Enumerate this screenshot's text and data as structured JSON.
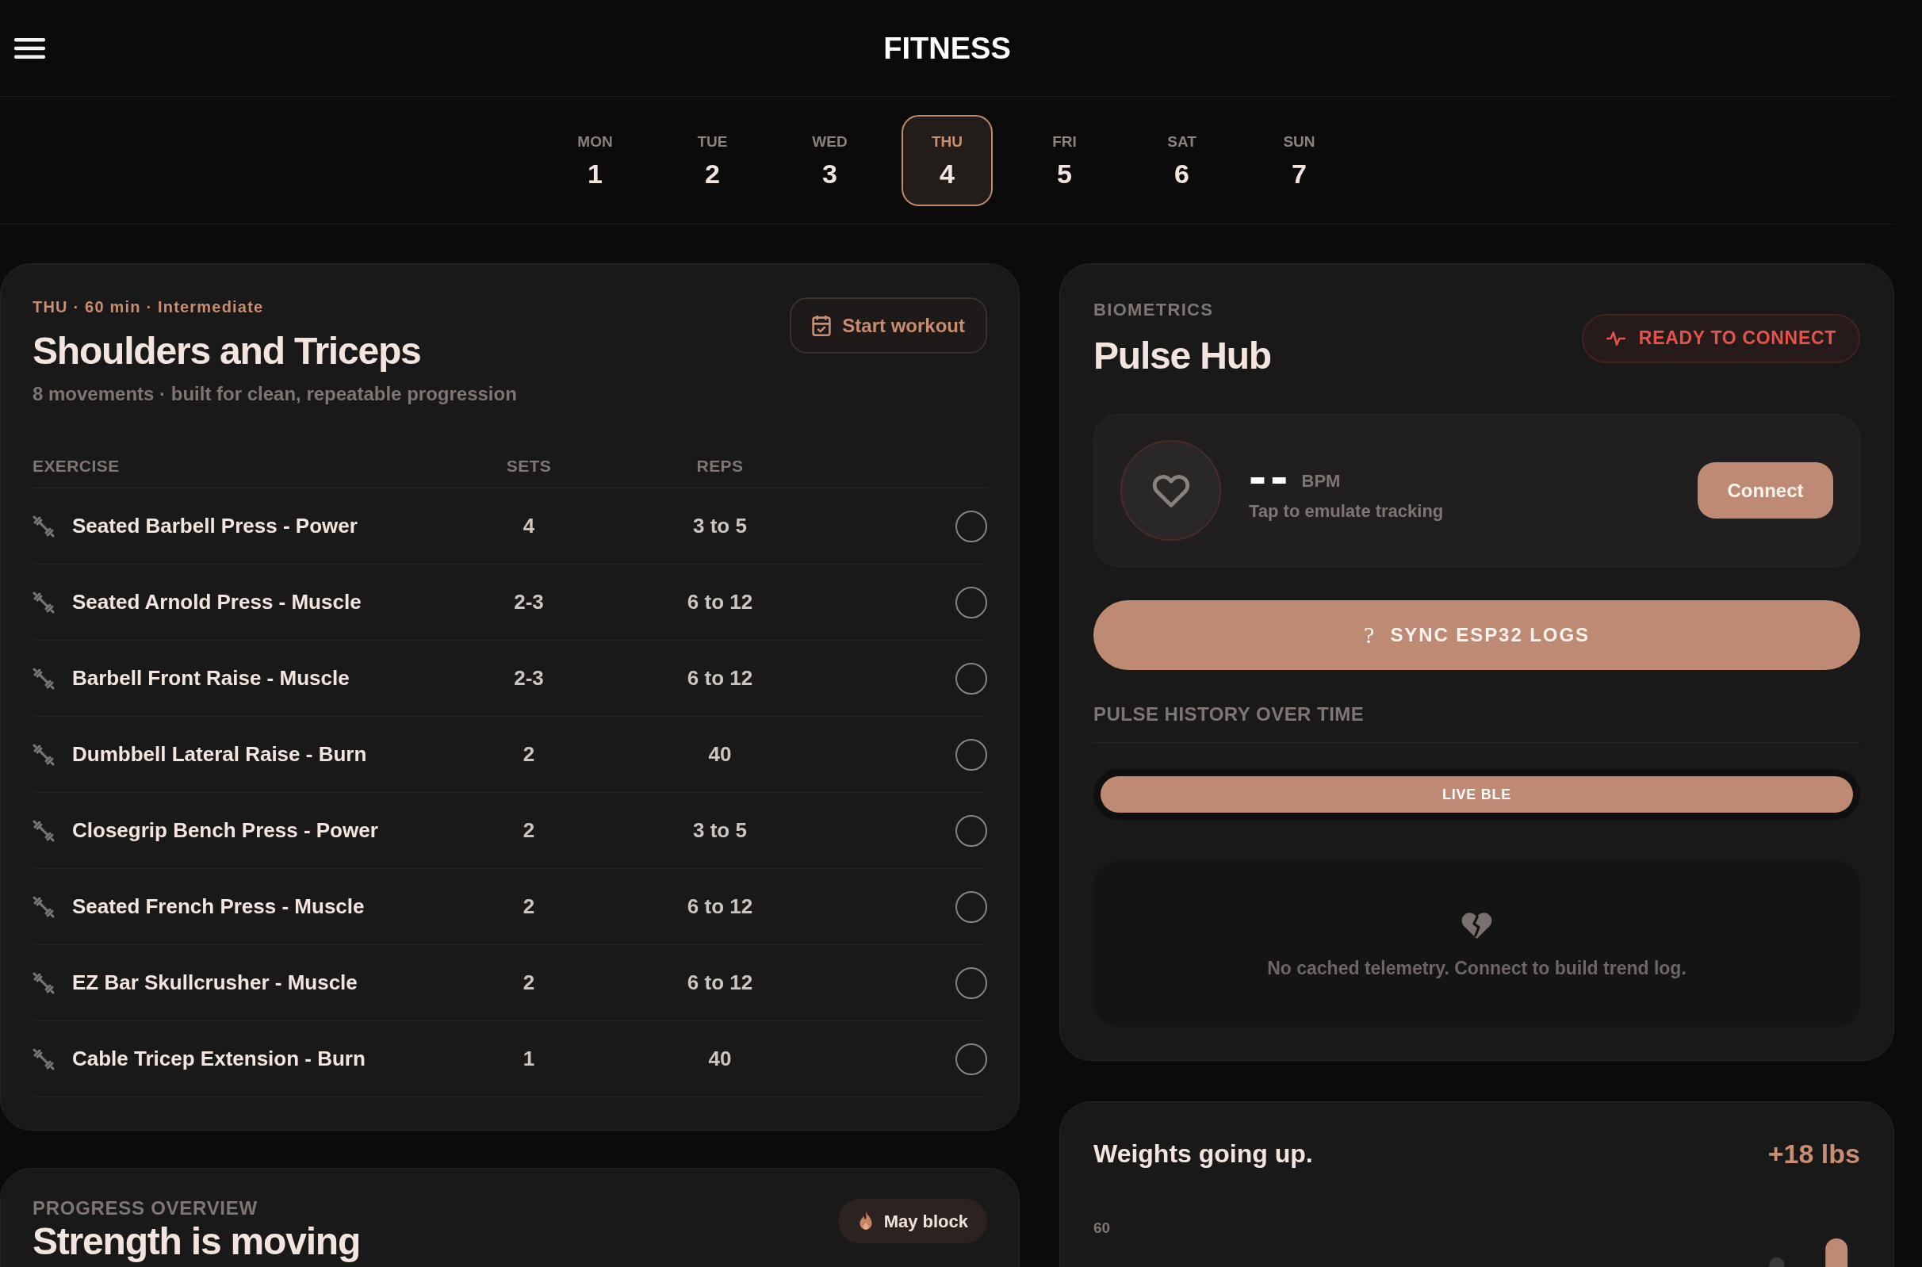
{
  "header": {
    "title": "FITNESS"
  },
  "days": [
    {
      "label": "MON",
      "date": "1",
      "selected": false
    },
    {
      "label": "TUE",
      "date": "2",
      "selected": false
    },
    {
      "label": "WED",
      "date": "3",
      "selected": false
    },
    {
      "label": "THU",
      "date": "4",
      "selected": true
    },
    {
      "label": "FRI",
      "date": "5",
      "selected": false
    },
    {
      "label": "SAT",
      "date": "6",
      "selected": false
    },
    {
      "label": "SUN",
      "date": "7",
      "selected": false
    }
  ],
  "workout": {
    "meta": "THU · 60 min · Intermediate",
    "title": "Shoulders and Triceps",
    "description": "8 movements · built for clean, repeatable progression",
    "start_button": "Start workout",
    "table": {
      "columns": [
        "EXERCISE",
        "SETS",
        "REPS"
      ],
      "rows": [
        {
          "exercise": "Seated Barbell Press - Power",
          "sets": "4",
          "reps": "3 to 5",
          "done": false
        },
        {
          "exercise": "Seated Arnold Press - Muscle",
          "sets": "2-3",
          "reps": "6 to 12",
          "done": false
        },
        {
          "exercise": "Barbell Front Raise - Muscle",
          "sets": "2-3",
          "reps": "6 to 12",
          "done": false
        },
        {
          "exercise": "Dumbbell Lateral Raise - Burn",
          "sets": "2",
          "reps": "40",
          "done": false
        },
        {
          "exercise": "Closegrip Bench Press - Power",
          "sets": "2",
          "reps": "3 to 5",
          "done": false
        },
        {
          "exercise": "Seated French Press - Muscle",
          "sets": "2",
          "reps": "6 to 12",
          "done": false
        },
        {
          "exercise": "EZ Bar Skullcrusher - Muscle",
          "sets": "2",
          "reps": "6 to 12",
          "done": false
        },
        {
          "exercise": "Cable Tricep Extension - Burn",
          "sets": "1",
          "reps": "40",
          "done": false
        }
      ]
    }
  },
  "progress": {
    "eyebrow": "PROGRESS OVERVIEW",
    "badge": "May block",
    "title": "Strength is moving"
  },
  "biometrics": {
    "eyebrow": "BIOMETRICS",
    "title": "Pulse Hub",
    "status": "READY TO CONNECT",
    "reading": {
      "value": "--",
      "unit": "BPM",
      "hint": "Tap to emulate tracking"
    },
    "connect_button": "Connect",
    "sync_button": {
      "icon": "?",
      "label": "SYNC ESP32 LOGS"
    },
    "history": {
      "heading": "PULSE HISTORY OVER TIME",
      "modes": [
        {
          "label": "LIVE BLE",
          "selected": true
        }
      ],
      "empty_message": "No cached telemetry. Connect to build trend log."
    }
  },
  "weights": {
    "title": "Weights going up.",
    "delta": "+18 lbs",
    "axis_labels": [
      "60"
    ]
  }
}
